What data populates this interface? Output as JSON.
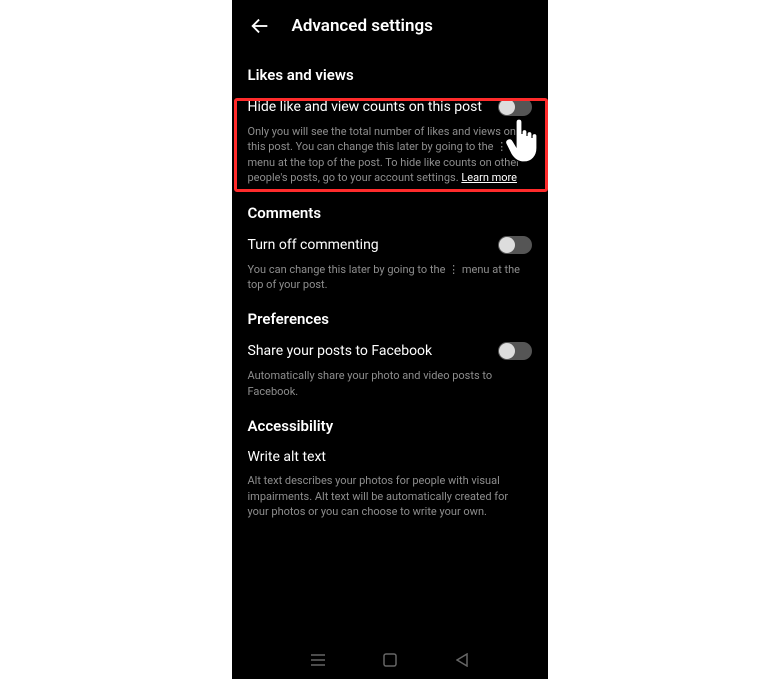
{
  "header": {
    "title": "Advanced settings"
  },
  "sections": {
    "likes": {
      "title": "Likes and views",
      "setting_label": "Hide like and view counts on this post",
      "desc_part1": "Only you will see the total number of likes and views on this post. You can change this later by going to the ⋮ menu at the top of the post. To hide like counts on other people's posts, go to your account settings. ",
      "learn_more": "Learn more"
    },
    "comments": {
      "title": "Comments",
      "setting_label": "Turn off commenting",
      "desc": "You can change this later by going to the ⋮ menu at the top of your post."
    },
    "preferences": {
      "title": "Preferences",
      "setting_label": "Share your posts to Facebook",
      "desc": "Automatically share your photo and video posts to Facebook."
    },
    "accessibility": {
      "title": "Accessibility",
      "setting_label": "Write alt text",
      "desc": "Alt text describes your photos for people with visual impairments. Alt text will be automatically created for your photos or you can choose to write your own."
    }
  }
}
